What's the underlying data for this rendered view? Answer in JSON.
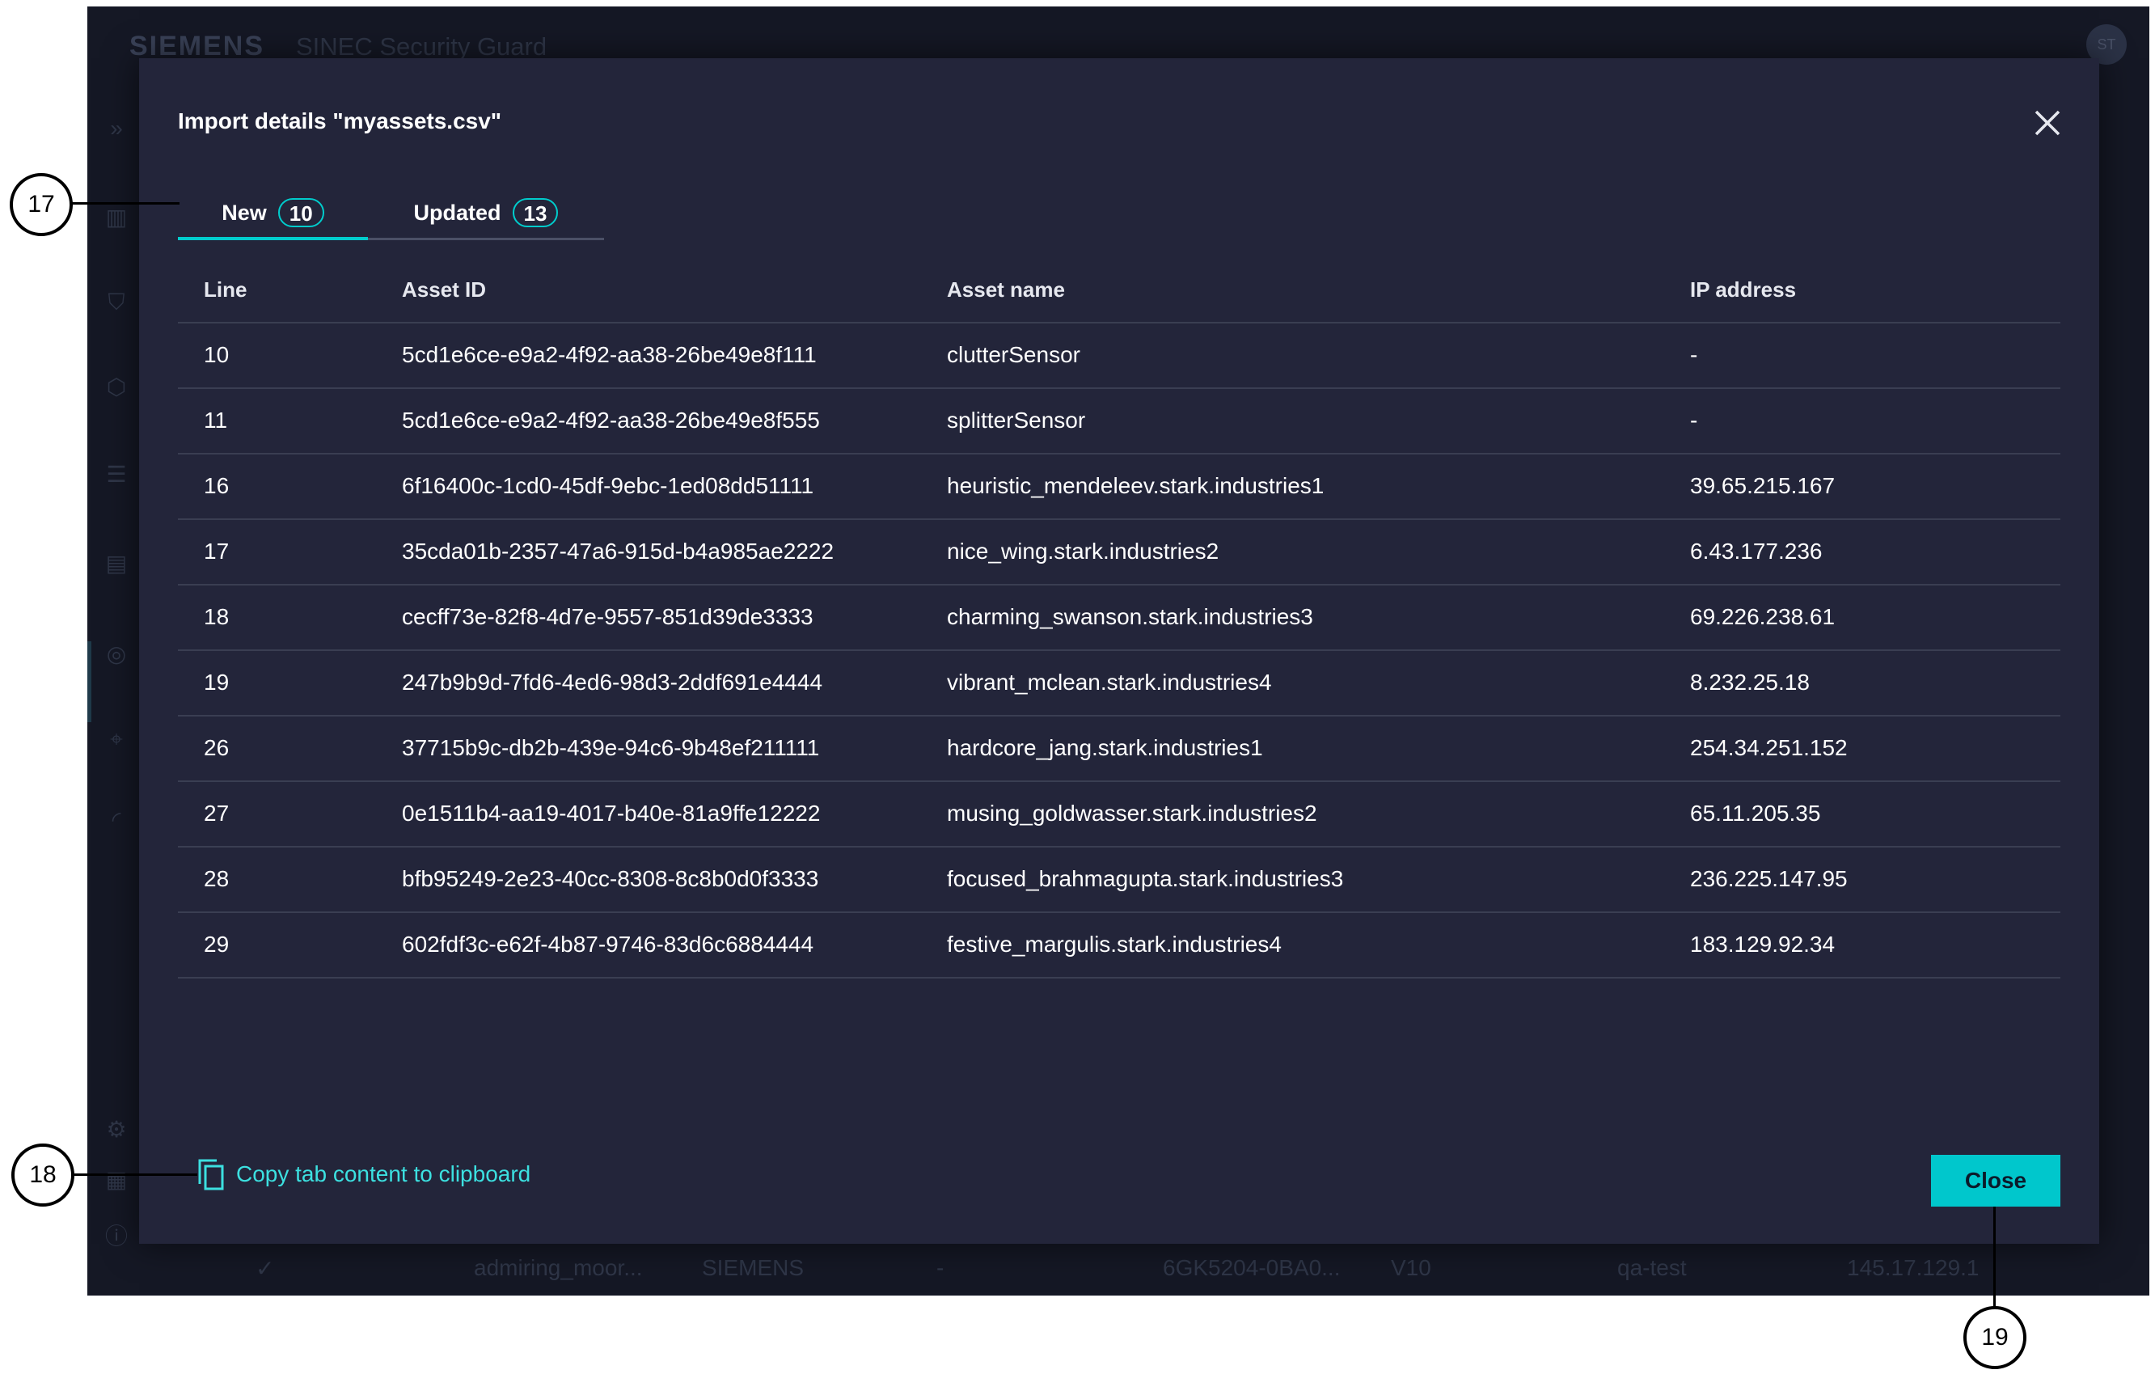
{
  "app": {
    "brand": "SIEMENS",
    "product": "SINEC Security Guard",
    "avatar": "ST",
    "background_row": [
      "admiring_moor...",
      "SIEMENS",
      "-",
      "6GK5204-0BA0...",
      "V10",
      "qa-test",
      "145.17.129.1"
    ]
  },
  "modal": {
    "title": "Import details \"myassets.csv\"",
    "tabs": [
      {
        "label": "New",
        "count": "10"
      },
      {
        "label": "Updated",
        "count": "13"
      }
    ],
    "columns": [
      "Line",
      "Asset ID",
      "Asset name",
      "IP address"
    ],
    "rows": [
      [
        "10",
        "5cd1e6ce-e9a2-4f92-aa38-26be49e8f111",
        "clutterSensor",
        "-"
      ],
      [
        "11",
        "5cd1e6ce-e9a2-4f92-aa38-26be49e8f555",
        "splitterSensor",
        "-"
      ],
      [
        "16",
        "6f16400c-1cd0-45df-9ebc-1ed08dd51111",
        "heuristic_mendeleev.stark.industries1",
        "39.65.215.167"
      ],
      [
        "17",
        "35cda01b-2357-47a6-915d-b4a985ae2222",
        "nice_wing.stark.industries2",
        "6.43.177.236"
      ],
      [
        "18",
        "cecff73e-82f8-4d7e-9557-851d39de3333",
        "charming_swanson.stark.industries3",
        "69.226.238.61"
      ],
      [
        "19",
        "247b9b9d-7fd6-4ed6-98d3-2ddf691e4444",
        "vibrant_mclean.stark.industries4",
        "8.232.25.18"
      ],
      [
        "26",
        "37715b9c-db2b-439e-94c6-9b48ef211111",
        "hardcore_jang.stark.industries1",
        "254.34.251.152"
      ],
      [
        "27",
        "0e1511b4-aa19-4017-b40e-81a9ffe12222",
        "musing_goldwasser.stark.industries2",
        "65.11.205.35"
      ],
      [
        "28",
        "bfb95249-2e23-40cc-8308-8c8b0d0f3333",
        "focused_brahmagupta.stark.industries3",
        "236.225.147.95"
      ],
      [
        "29",
        "602fdf3c-e62f-4b87-9746-83d6c6884444",
        "festive_margulis.stark.industries4",
        "183.129.92.34"
      ]
    ],
    "copy_label": "Copy tab content to clipboard",
    "close_label": "Close"
  },
  "callouts": [
    "17",
    "18",
    "19"
  ],
  "colors": {
    "accent": "#00c7cc",
    "modal_bg": "#23253a",
    "app_bg": "#151825"
  }
}
